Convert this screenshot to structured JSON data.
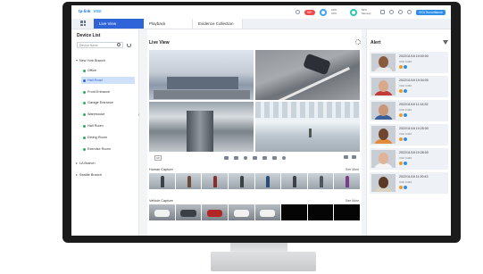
{
  "topbar": {
    "brand_tplink": "tp-link",
    "brand_vigi": "VIGI",
    "alarm_count": "99+",
    "meter1": "10%",
    "meter1_label": "CPU",
    "meter2": "54%",
    "meter2_label": "Memory",
    "user_label": "VIGI Surveillance"
  },
  "tabs": [
    "Live View",
    "Playback",
    "Evidence Collection"
  ],
  "sidebar": {
    "title": "Device List",
    "search_placeholder": "Device Name",
    "items": [
      {
        "label": "New York Branch",
        "type": "group"
      },
      {
        "label": "Office",
        "type": "camera"
      },
      {
        "label": "Hall Road",
        "type": "camera",
        "selected": true
      },
      {
        "label": "Front Entrance",
        "type": "camera"
      },
      {
        "label": "Garage Entrance",
        "type": "camera"
      },
      {
        "label": "Warehouse",
        "type": "camera"
      },
      {
        "label": "Hall Room",
        "type": "camera"
      },
      {
        "label": "Dining Room",
        "type": "camera"
      },
      {
        "label": "Exercise Room",
        "type": "camera"
      },
      {
        "label": "LA Branch",
        "type": "group"
      },
      {
        "label": "Seattle Branch",
        "type": "group"
      }
    ]
  },
  "main": {
    "title": "Live View",
    "quality": "HD",
    "human_label": "Human Capture",
    "vehicle_label": "Vehicle Capture",
    "see_more": "See More"
  },
  "alert": {
    "title": "Alert",
    "items": [
      {
        "time": "2022/11/18 10:00:00",
        "camera": "VIGI C440",
        "skin": "#8a5a3c",
        "shirt": "#e9e9e9"
      },
      {
        "time": "2022/11/18 10:34:00",
        "camera": "VIGI C440",
        "skin": "#d9a98c",
        "shirt": "#c23b3b"
      },
      {
        "time": "2022/11/18 11:14:32",
        "camera": "VIGI C440",
        "skin": "#c99777",
        "shirt": "#3a5f99"
      },
      {
        "time": "2022/11/18 10:25:00",
        "camera": "VIGI C440",
        "skin": "#6f4630",
        "shirt": "#e28b3a"
      },
      {
        "time": "2022/11/18 10:28:00",
        "camera": "VIGI C440",
        "skin": "#e0b49a",
        "shirt": "#f4f4f4"
      },
      {
        "time": "2022/11/18 11:20:43",
        "camera": "VIGI C440",
        "skin": "#5b3a28",
        "shirt": "#d9d2c3"
      }
    ]
  },
  "colors": {
    "accent": "#2f63d8",
    "selected_bg": "#cfe0fb",
    "alarm": "#f04848"
  }
}
